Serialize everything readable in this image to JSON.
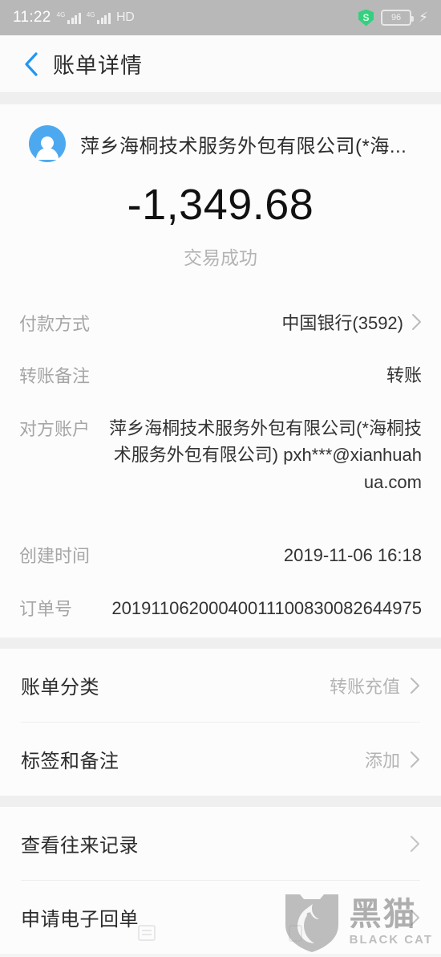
{
  "statusbar": {
    "time": "11:22",
    "network_label": "HD",
    "battery_level": "96",
    "shield_icon": "shield-icon",
    "charging_icon": "charging-bolt-icon",
    "signal_icon": "signal-bars-icon"
  },
  "header": {
    "title": "账单详情",
    "back_icon": "chevron-left-icon"
  },
  "summary": {
    "merchant": "萍乡海桐技术服务外包有限公司(*海...",
    "amount": "-1,349.68",
    "status": "交易成功",
    "avatar_icon": "user-avatar-icon"
  },
  "details": [
    {
      "label": "付款方式",
      "value": "中国银行(3592)",
      "chevron": true,
      "muted": false
    },
    {
      "label": "转账备注",
      "value": "转账",
      "chevron": false,
      "muted": false
    },
    {
      "label": "对方账户",
      "value": "萍乡海桐技术服务外包有限公司(*海桐技术服务外包有限公司) pxh***@xianhuahua.com",
      "chevron": false,
      "muted": false
    },
    {
      "label": "创建时间",
      "value": "2019-11-06 16:18",
      "chevron": false,
      "muted": false
    },
    {
      "label": "订单号",
      "value": "20191106200040011100830082644975",
      "chevron": false,
      "muted": false
    }
  ],
  "settings": [
    {
      "label": "账单分类",
      "value": "转账充值"
    },
    {
      "label": "标签和备注",
      "value": "添加"
    }
  ],
  "actions": [
    {
      "label": "查看往来记录"
    },
    {
      "label": "申请电子回单"
    }
  ],
  "watermark": {
    "cn": "黑猫",
    "en": "BLACK CAT",
    "logo_icon": "black-cat-shield-icon"
  },
  "navbar": {
    "recents_icon": "recents-icon",
    "home_icon": "home-square-icon"
  },
  "colors": {
    "accent": "#4da9ef",
    "statusbar_bg": "#b8b8b8",
    "muted_text": "#b4b4b4",
    "page_bg": "#efefef"
  }
}
